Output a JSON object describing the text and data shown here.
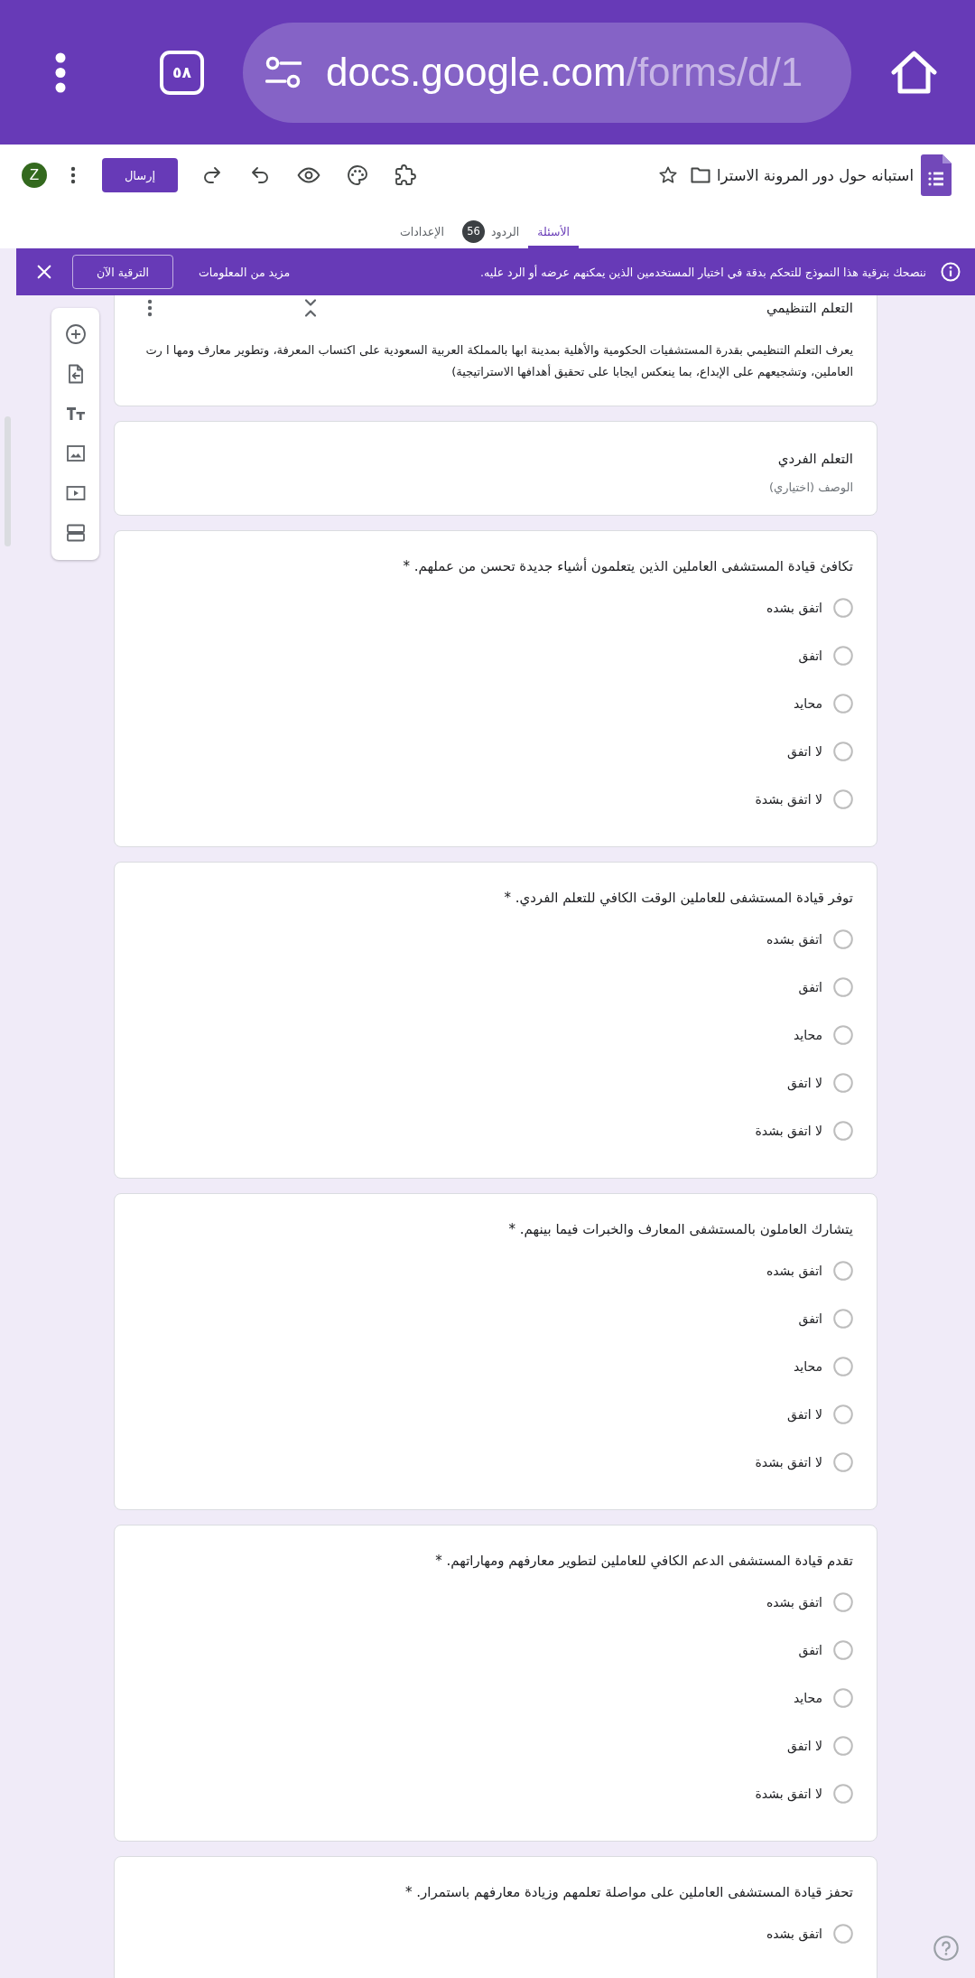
{
  "browser": {
    "tab_count": "٥٨",
    "url_host": "docs.google.com",
    "url_path": "/forms/d/1"
  },
  "header": {
    "title": "استبانه حول دور المرونة الاسترا",
    "send_button": "إرسال",
    "avatar": "Z"
  },
  "tabs": [
    {
      "label": "الأسئلة",
      "selected": true
    },
    {
      "label": "الردود",
      "selected": false,
      "badge": "56"
    },
    {
      "label": "الإعدادات",
      "selected": false
    }
  ],
  "banner": {
    "message": "ننصحك بترقية هذا النموذج للتحكم بدقة في اختيار المستخدمين الذين يمكنهم عرضه أو الرد عليه.",
    "link": "مزيد من المعلومات",
    "button": "الترقية الآن"
  },
  "sections": [
    {
      "kind": "section",
      "title": "التعلم التنظيمي",
      "description": "يعرف التعلم التنظيمي بقدرة المستشفيات الحكومية والأهلية بمدينة ابها بالمملكة العربية السعودية على اكتساب المعرفة، وتطوير معارف ومها ا رت العاملين، وتشجيعهم على الإبداع، بما ينعكس ايجابا على تحقيق أهدافها الاستراتيجية)"
    },
    {
      "kind": "title",
      "title": "التعلم الفردي",
      "placeholder": "الوصف (اختياري)"
    }
  ],
  "questions": [
    {
      "text": "تكافئ قيادة المستشفى العاملين الذين يتعلمون أشياء جديدة تحسن من عملهم. *",
      "options": [
        {
          "label": "اتفق بشده",
          "selected": false
        },
        {
          "label": "اتفق",
          "selected": false
        },
        {
          "label": "محايد",
          "selected": false
        },
        {
          "label": "لا اتفق",
          "selected": false
        },
        {
          "label": "لا اتفق بشدة",
          "selected": false
        }
      ]
    },
    {
      "text": "توفر قيادة المستشفى للعاملين الوقت الكافي للتعلم الفردي. *",
      "options": [
        {
          "label": "اتفق بشده",
          "selected": false
        },
        {
          "label": "اتفق",
          "selected": false
        },
        {
          "label": "محايد",
          "selected": false
        },
        {
          "label": "لا اتفق",
          "selected": false
        },
        {
          "label": "لا اتفق بشدة",
          "selected": false
        }
      ]
    },
    {
      "text": "يتشارك العاملون بالمستشفى المعارف والخبرات فيما بينهم. *",
      "options": [
        {
          "label": "اتفق بشده",
          "selected": false
        },
        {
          "label": "اتفق",
          "selected": false
        },
        {
          "label": "محايد",
          "selected": false
        },
        {
          "label": "لا اتفق",
          "selected": false
        },
        {
          "label": "لا اتفق بشدة",
          "selected": false
        }
      ]
    },
    {
      "text": "تقدم قيادة المستشفى الدعم الكافي للعاملين لتطوير معارفهم ومهاراتهم. *",
      "options": [
        {
          "label": "اتفق بشده",
          "selected": false
        },
        {
          "label": "اتفق",
          "selected": false
        },
        {
          "label": "محايد",
          "selected": false
        },
        {
          "label": "لا اتفق",
          "selected": false
        },
        {
          "label": "لا اتفق بشدة",
          "selected": false
        }
      ]
    },
    {
      "text": "تحفز قيادة المستشفى العاملين على مواصلة تعلمهم وزيادة معارفهم باستمرار. *",
      "options": [
        {
          "label": "اتفق بشده",
          "selected": false
        }
      ]
    }
  ]
}
